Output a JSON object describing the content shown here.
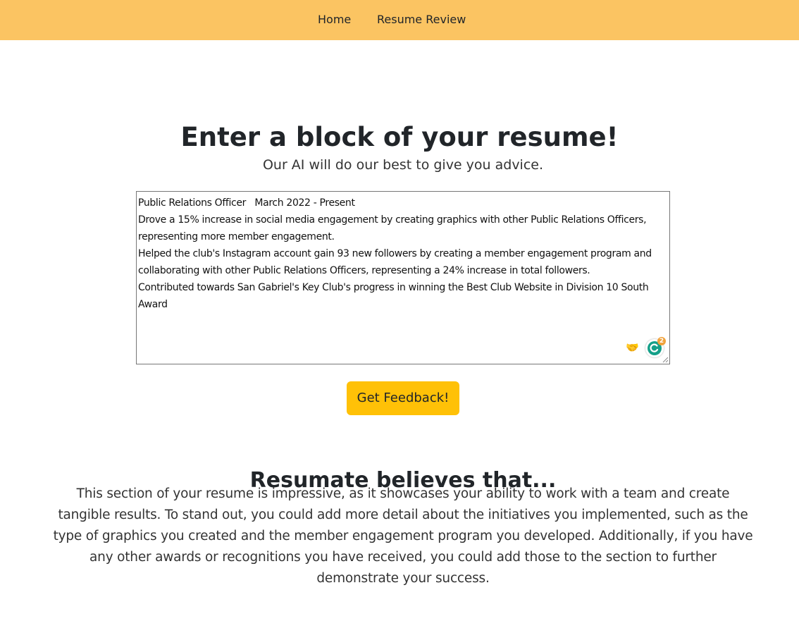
{
  "nav": {
    "items": [
      {
        "label": "Home"
      },
      {
        "label": "Resume Review"
      }
    ],
    "background_color": "#fbc462"
  },
  "main": {
    "title": "Enter a block of your resume!",
    "subtitle": "Our AI will do our best to give you advice.",
    "resume_input": {
      "value": "Public Relations Officer   March 2022 - Present\nDrove a 15% increase in social media engagement by creating graphics with other Public Relations Officers, representing more member engagement.\nHelped the club's Instagram account gain 93 new followers by creating a member engagement program and collaborating with other Public Relations Officers, representing a 24% increase in total followers.\nContributed towards San Gabriel's Key Club's progress in winning the Best Club Website in Division 10 South Award",
      "extension_icons": [
        "handshake-icon",
        "grammar-assistant-icon"
      ],
      "assistant_badge_count": "2"
    },
    "submit_label": "Get Feedback!",
    "submit_color": "#ffc107"
  },
  "feedback": {
    "heading": "Resumate believes that...",
    "text": "This section of your resume is impressive, as it showcases your ability to work with a team and create tangible results. To stand out, you could add more detail about the initiatives you implemented, such as the type of graphics you created and the member engagement program you developed. Additionally, if you have any other awards or recognitions you have received, you could add those to the section to further demonstrate your success."
  }
}
